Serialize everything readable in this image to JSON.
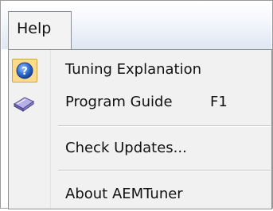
{
  "menubar": {
    "menu_title": "Help"
  },
  "menu": {
    "items": [
      {
        "label": "Tuning Explanation",
        "icon": "help-circle-icon",
        "checked": true
      },
      {
        "label": "Program Guide",
        "shortcut": "F1",
        "icon": "book-icon"
      },
      {
        "label": "Check Updates..."
      },
      {
        "label": "About AEMTuner"
      }
    ]
  },
  "colors": {
    "check_highlight": "#fddb8c",
    "help_icon_blue": "#2f6fd0",
    "book_icon_purple": "#8a82c9"
  }
}
